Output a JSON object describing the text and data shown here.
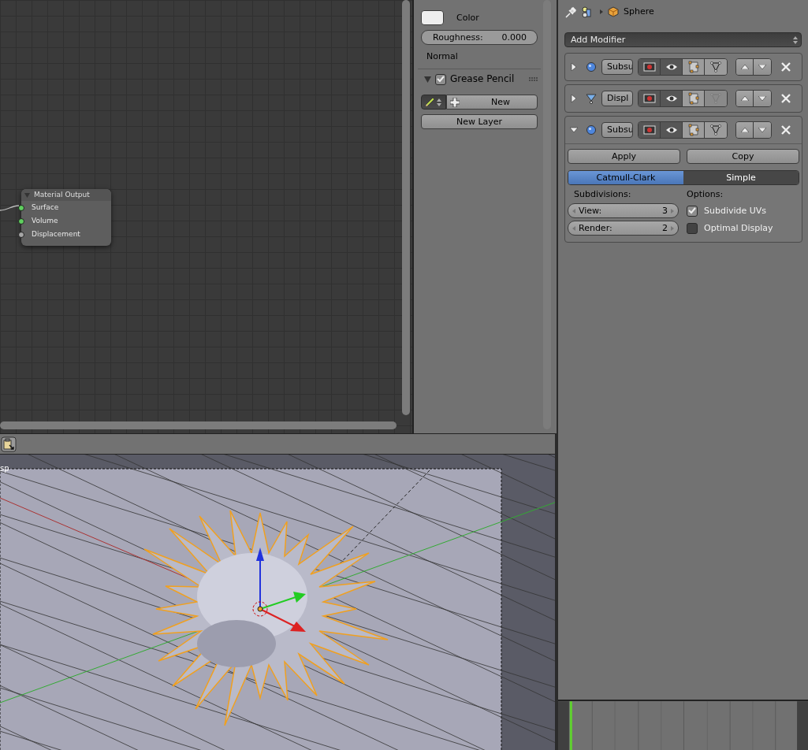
{
  "node_editor": {
    "node": {
      "title": "Material Output",
      "expanded": true,
      "sockets": [
        {
          "label": "Surface",
          "color": "#5fcf5f"
        },
        {
          "label": "Volume",
          "color": "#5fcf5f"
        },
        {
          "label": "Displacement",
          "color": "#a6a6a6"
        }
      ]
    }
  },
  "material_panel": {
    "color_label": "Color",
    "roughness": {
      "label": "Roughness:",
      "value": "0.000",
      "level": 0
    },
    "normal_label": "Normal"
  },
  "grease_pencil": {
    "title": "Grease Pencil",
    "expanded": true,
    "checked": true,
    "new_button": "New",
    "new_layer_button": "New Layer"
  },
  "viewport": {
    "label": "sp"
  },
  "properties": {
    "breadcrumb": "Sphere",
    "add_modifier": "Add Modifier",
    "modifiers": [
      {
        "kind": "subsurf",
        "name": "Subsu",
        "expanded": false,
        "cage": true
      },
      {
        "kind": "displace",
        "name": "Displ",
        "expanded": false,
        "cage": false
      },
      {
        "kind": "subsurf",
        "name": "Subsu",
        "expanded": true,
        "cage": true,
        "settings": {
          "apply": "Apply",
          "copy": "Copy",
          "tabs": [
            {
              "label": "Catmull-Clark",
              "selected": true
            },
            {
              "label": "Simple",
              "selected": false
            }
          ],
          "subdivisions_heading": "Subdivisions:",
          "fields": [
            {
              "label": "View:",
              "value": "3"
            },
            {
              "label": "Render:",
              "value": "2"
            }
          ],
          "options_heading": "Options:",
          "options": [
            {
              "label": "Subdivide UVs",
              "checked": true
            },
            {
              "label": "Optimal Display",
              "checked": false
            }
          ]
        }
      }
    ]
  }
}
